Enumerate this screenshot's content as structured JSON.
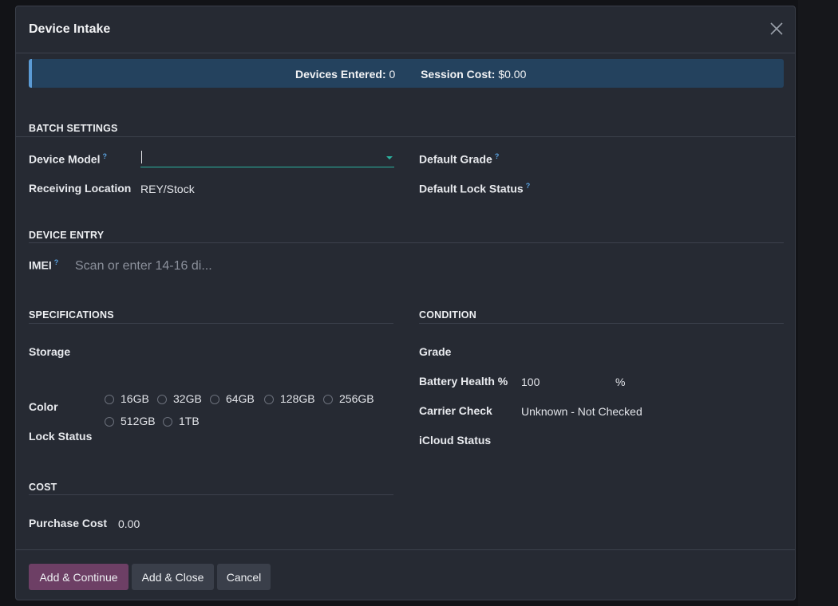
{
  "modal": {
    "title": "Device Intake"
  },
  "banner": {
    "devices_label": "Devices Entered:",
    "devices_value": "0",
    "cost_label": "Session Cost:",
    "cost_value": "$0.00"
  },
  "batch_settings": {
    "title": "BATCH SETTINGS",
    "device_model_label": "Device Model",
    "device_model_value": "",
    "receiving_location_label": "Receiving Location",
    "receiving_location_value": "REY/Stock",
    "default_grade_label": "Default Grade",
    "default_lock_status_label": "Default Lock Status",
    "help_mark": "?"
  },
  "device_entry": {
    "title": "DEVICE ENTRY",
    "imei_label": "IMEI",
    "imei_value": "",
    "imei_placeholder": "Scan or enter 14-16 di..."
  },
  "specifications": {
    "title": "SPECIFICATIONS",
    "storage_label": "Storage",
    "storage_options": [
      "16GB",
      "32GB",
      "64GB",
      "128GB",
      "256GB",
      "512GB",
      "1TB"
    ],
    "color_label": "Color",
    "lock_status_label": "Lock Status"
  },
  "condition": {
    "title": "CONDITION",
    "grade_label": "Grade",
    "battery_label": "Battery Health %",
    "battery_value": "100",
    "battery_unit": "%",
    "carrier_label": "Carrier Check",
    "carrier_value": "Unknown - Not Checked",
    "icloud_label": "iCloud Status"
  },
  "cost": {
    "title": "COST",
    "purchase_label": "Purchase Cost",
    "purchase_value": "0.00"
  },
  "footer": {
    "add_continue": "Add & Continue",
    "add_close": "Add & Close",
    "cancel": "Cancel"
  },
  "colors": {
    "primary_button": "#6d3f65",
    "banner_bg": "#24425e",
    "banner_accent": "#5b9bd5",
    "select_underline": "#2bb3a0",
    "help_icon": "#5aa2e0"
  }
}
